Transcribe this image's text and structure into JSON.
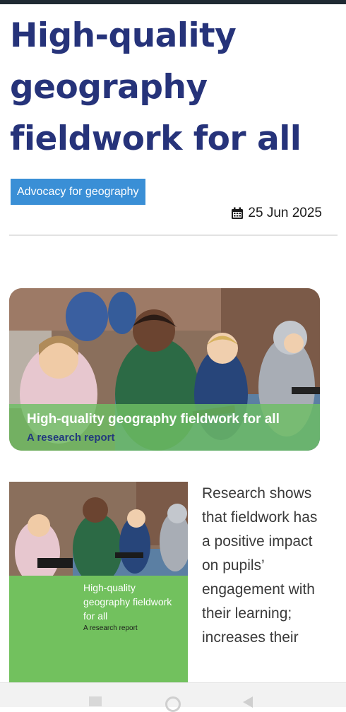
{
  "article": {
    "title": "High-quality geography fieldwork for all",
    "tag": "Advocacy for geography",
    "date": "25 Jun 2025",
    "date_icon": "calendar-icon"
  },
  "hero": {
    "title": "High-quality geography fieldwork for all",
    "subtitle": "A research report"
  },
  "cover": {
    "title": "High-quality geography fieldwork for all",
    "subtitle": "A research report"
  },
  "body": {
    "text": "Research shows that fieldwork has a positive impact on pupils’ engagement with their learning; increases their"
  },
  "colors": {
    "title": "#26337a",
    "tag_bg": "#3a8fd6",
    "green_band": "#72c15e"
  },
  "system_nav": {
    "icons": [
      "recent-apps-icon",
      "home-icon",
      "back-icon"
    ]
  }
}
